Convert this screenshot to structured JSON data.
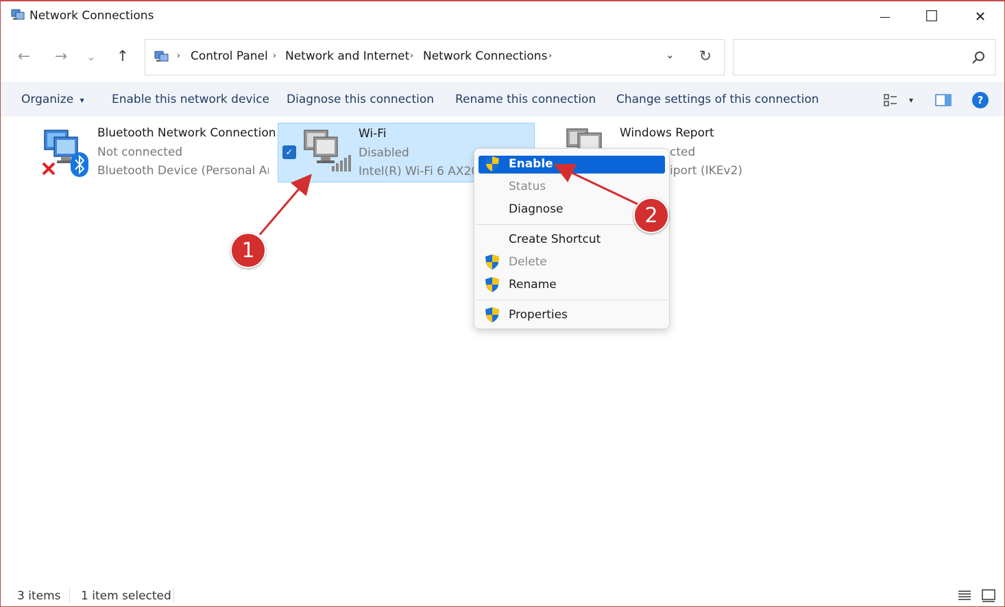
{
  "window": {
    "title": "Network Connections",
    "minimize_glyph": "—",
    "maximize_glyph": "☐",
    "close_glyph": "✕"
  },
  "nav": {
    "back_glyph": "←",
    "forward_glyph": "→",
    "recent_glyph": "⌄",
    "up_glyph": "↑",
    "breadcrumbs": [
      "Control Panel",
      "Network and Internet",
      "Network Connections"
    ],
    "separator": "›",
    "dropdown_glyph": "⌄",
    "refresh_glyph": "↻"
  },
  "search": {
    "value": "",
    "placeholder": ""
  },
  "commands": {
    "organize": "Organize",
    "organize_caret": "▾",
    "enable": "Enable this network device",
    "diagnose": "Diagnose this connection",
    "rename": "Rename this connection",
    "change_settings": "Change settings of this connection",
    "view_caret": "▾",
    "help_glyph": "?"
  },
  "items": [
    {
      "name": "Bluetooth Network Connection",
      "status": "Not connected",
      "device": "Bluetooth Device (Personal Ar..."
    },
    {
      "name": "Wi-Fi",
      "status": "Disabled",
      "device": "Intel(R) Wi-Fi 6 AX20",
      "checkbox": "✓"
    },
    {
      "name": "Windows Report",
      "status": "cted",
      "device": "iport (IKEv2)"
    }
  ],
  "context_menu": {
    "items": [
      {
        "label": "Enable"
      },
      {
        "label": "Status"
      },
      {
        "label": "Diagnose"
      },
      {
        "label": "Create Shortcut"
      },
      {
        "label": "Delete"
      },
      {
        "label": "Rename"
      },
      {
        "label": "Properties"
      }
    ]
  },
  "annotations": {
    "step1": "1",
    "step2": "2",
    "callout_color": "#d32f2f"
  },
  "statusbar": {
    "item_count": "3 items",
    "selected": "1 item selected"
  },
  "colors": {
    "selection": "#cce8ff",
    "menu_highlight": "#0a66d8",
    "command_bar": "#f0f4f9"
  }
}
